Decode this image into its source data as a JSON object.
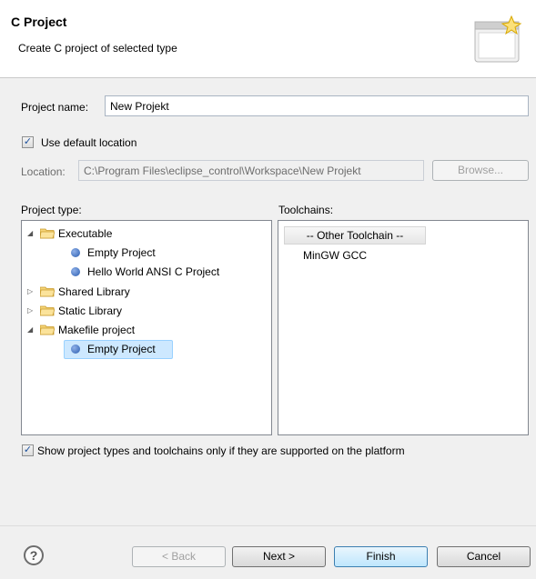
{
  "header": {
    "title": "C Project",
    "description": "Create C project of selected type"
  },
  "project_name": {
    "label": "Project name:",
    "value": "New Projekt"
  },
  "use_default_location": {
    "label": "Use default location",
    "checked": true
  },
  "location": {
    "label": "Location:",
    "value": "C:\\Program Files\\eclipse_control\\Workspace\\New Projekt",
    "browse_label": "Browse..."
  },
  "project_type": {
    "label": "Project type:",
    "tree": [
      {
        "label": "Executable",
        "expanded": true,
        "kind": "folder"
      },
      {
        "label": "Empty Project",
        "kind": "leaf"
      },
      {
        "label": "Hello World ANSI C Project",
        "kind": "leaf"
      },
      {
        "label": "Shared Library",
        "expanded": false,
        "kind": "folder"
      },
      {
        "label": "Static Library",
        "expanded": false,
        "kind": "folder"
      },
      {
        "label": "Makefile project",
        "expanded": true,
        "kind": "folder"
      },
      {
        "label": "Empty Project",
        "kind": "leaf",
        "selected": true
      }
    ]
  },
  "toolchains": {
    "label": "Toolchains:",
    "items": [
      "-- Other Toolchain --",
      "MinGW GCC"
    ]
  },
  "show_supported": {
    "label": "Show project types and toolchains only if they are supported on the platform",
    "checked": true
  },
  "footer": {
    "help_glyph": "?",
    "back_label": "< Back",
    "next_label": "Next >",
    "finish_label": "Finish",
    "cancel_label": "Cancel"
  },
  "icons": {
    "help": "help-icon",
    "wizard": "wizard-banner-icon",
    "folder": "folder-icon",
    "leaf": "project-type-icon"
  },
  "colors": {
    "selection": "#cde8ff",
    "default_button": "#bee6fd"
  }
}
